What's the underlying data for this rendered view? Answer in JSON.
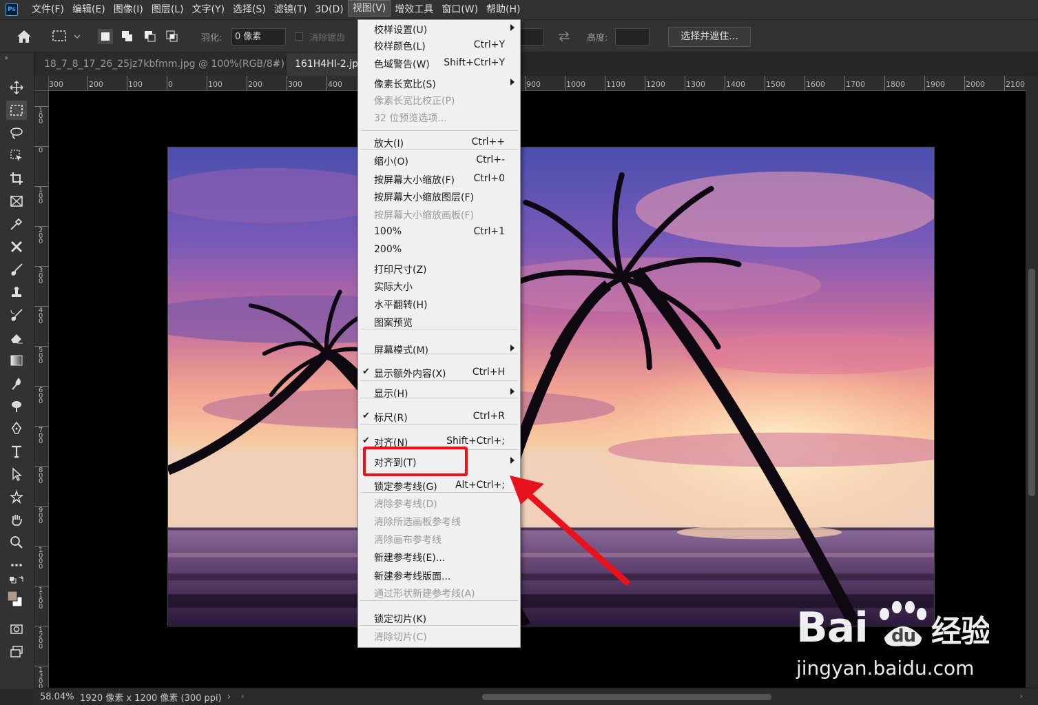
{
  "app": {
    "logo_text": "Ps"
  },
  "menubar": {
    "items": [
      {
        "label": "文件(F)"
      },
      {
        "label": "编辑(E)"
      },
      {
        "label": "图像(I)"
      },
      {
        "label": "图层(L)"
      },
      {
        "label": "文字(Y)"
      },
      {
        "label": "选择(S)"
      },
      {
        "label": "滤镜(T)"
      },
      {
        "label": "3D(D)"
      },
      {
        "label": "视图(V)",
        "active": true
      },
      {
        "label": "增效工具"
      },
      {
        "label": "窗口(W)"
      },
      {
        "label": "帮助(H)"
      }
    ]
  },
  "options": {
    "feather_label": "羽化:",
    "feather_value": "0 像素",
    "antialias_label": "消除锯齿",
    "height_label": "高度:",
    "select_mask_button": "选择并遮住..."
  },
  "tabs": [
    {
      "label": "18_7_8_17_26_25jz7kbfmm.jpg @ 100%(RGB/8#)",
      "close": "✕"
    },
    {
      "label": "161H4HI-2.jpg"
    }
  ],
  "ruler": {
    "h_labels": [
      "300",
      "200",
      "100",
      "0",
      "100",
      "200",
      "300",
      "400",
      "900",
      "1000",
      "1100",
      "1200",
      "1300",
      "1400",
      "1500",
      "1600",
      "1700",
      "1800",
      "1900",
      "2000",
      "2100"
    ],
    "v_labels": [
      "100",
      "0",
      "100",
      "200",
      "300",
      "400",
      "500",
      "600",
      "700",
      "800",
      "900",
      "1000",
      "1100",
      "1200",
      "1300"
    ]
  },
  "view_menu": {
    "items": [
      {
        "label": "校样设置(U)",
        "shortcut": "",
        "submenu": true
      },
      {
        "label": "校样颜色(L)",
        "shortcut": "Ctrl+Y"
      },
      {
        "label": "色域警告(W)",
        "shortcut": "Shift+Ctrl+Y"
      },
      {
        "label": "像素长宽比(S)",
        "shortcut": "",
        "submenu": true
      },
      {
        "label": "像素长宽比校正(P)",
        "shortcut": "",
        "disabled": true
      },
      {
        "label": "32 位预览选项...",
        "shortcut": "",
        "disabled": true
      },
      {
        "label": "放大(I)",
        "shortcut": "Ctrl++"
      },
      {
        "label": "缩小(O)",
        "shortcut": "Ctrl+-"
      },
      {
        "label": "按屏幕大小缩放(F)",
        "shortcut": "Ctrl+0"
      },
      {
        "label": "按屏幕大小缩放图层(F)",
        "shortcut": ""
      },
      {
        "label": "按屏幕大小缩放画板(F)",
        "shortcut": "",
        "disabled": true
      },
      {
        "label": "100%",
        "shortcut": "Ctrl+1"
      },
      {
        "label": "200%",
        "shortcut": ""
      },
      {
        "label": "打印尺寸(Z)",
        "shortcut": ""
      },
      {
        "label": "实际大小",
        "shortcut": ""
      },
      {
        "label": "水平翻转(H)",
        "shortcut": ""
      },
      {
        "label": "图案预览",
        "shortcut": ""
      },
      {
        "label": "屏幕模式(M)",
        "shortcut": "",
        "submenu": true
      },
      {
        "label": "显示额外内容(X)",
        "shortcut": "Ctrl+H",
        "checked": true
      },
      {
        "label": "显示(H)",
        "shortcut": "",
        "submenu": true
      },
      {
        "label": "标尺(R)",
        "shortcut": "Ctrl+R",
        "checked": true
      },
      {
        "label": "对齐(N)",
        "shortcut": "Shift+Ctrl+;",
        "checked": true
      },
      {
        "label": "对齐到(T)",
        "shortcut": "",
        "submenu": true
      },
      {
        "label": "锁定参考线(G)",
        "shortcut": "Alt+Ctrl+;"
      },
      {
        "label": "清除参考线(D)",
        "shortcut": "",
        "disabled": true
      },
      {
        "label": "清除所选画板参考线",
        "shortcut": "",
        "disabled": true
      },
      {
        "label": "清除画布参考线",
        "shortcut": "",
        "disabled": true
      },
      {
        "label": "新建参考线(E)...",
        "shortcut": ""
      },
      {
        "label": "新建参考线版面...",
        "shortcut": ""
      },
      {
        "label": "通过形状新建参考线(A)",
        "shortcut": "",
        "disabled": true
      },
      {
        "label": "锁定切片(K)",
        "shortcut": ""
      },
      {
        "label": "清除切片(C)",
        "shortcut": "",
        "disabled": true
      }
    ]
  },
  "status": {
    "zoom": "58.04%",
    "doc_info": "1920 像素 x 1200 像素 (300 ppi)",
    "arrow": "›"
  },
  "watermark": {
    "logo": "Bai du 经验",
    "url": "jingyan.baidu.com"
  },
  "colors": {
    "highlight": "#e8121d",
    "menu_bg": "#f0f0f0"
  }
}
